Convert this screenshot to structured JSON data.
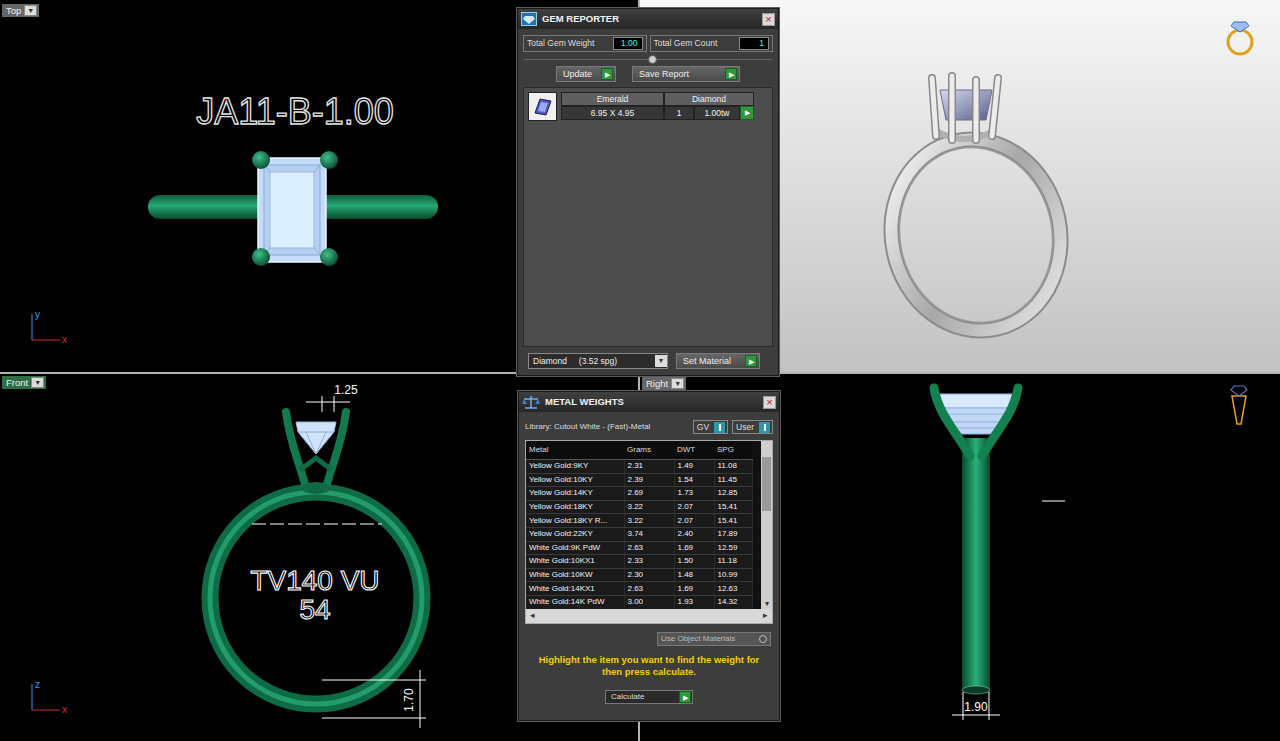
{
  "top_view": {
    "label": "Top",
    "menu": "▼",
    "selected": false,
    "part_code": "JA11-B-1.00",
    "axis_vertical": "y",
    "axis_horizontal": "x"
  },
  "front_view": {
    "label": "Front",
    "menu": "▼",
    "selected": true,
    "dimension_top": "1.25",
    "stamp_lines": [
      "TV140 VU",
      "54"
    ],
    "dimension_side": "1.70",
    "axis_vertical": "z",
    "axis_horizontal": "x"
  },
  "right_view": {
    "label": "Right",
    "menu": "▼",
    "selected": false,
    "dimension_bottom": "1.90"
  },
  "gem_reporter": {
    "title": "GEM REPORTER",
    "close": "×",
    "total_weight_label": "Total Gem Weight",
    "total_weight": "1.00",
    "total_count_label": "Total Gem Count",
    "total_count": "1",
    "buttons": [
      {
        "label": "Update",
        "arrow": "▶"
      },
      {
        "label": "Save Report",
        "arrow": "▶"
      }
    ],
    "gems": [
      {
        "shape": "Emerald",
        "size": "6.95 X 4.95",
        "material": "Diamond",
        "count": "1",
        "weight": "1.00tw",
        "arrow": "▶"
      }
    ],
    "material": "Diamond     (3.52 spg)",
    "material_arrow": "▼",
    "set_material": {
      "label": "Set Material",
      "arrow": "▶"
    }
  },
  "metal_weights": {
    "title": "METAL WEIGHTS",
    "close": "×",
    "library": "Library: Cutout White - (Fast)-Metal",
    "toggles": [
      {
        "label": "GV",
        "on": true
      },
      {
        "label": "User",
        "on": true
      }
    ],
    "columns": [
      "Metal",
      "Grams",
      "DWT",
      "SPG"
    ],
    "rows": [
      [
        "Yellow Gold:9KY",
        "2.31",
        "1.49",
        "11.08"
      ],
      [
        "Yellow Gold:10KY",
        "2.39",
        "1.54",
        "11.45"
      ],
      [
        "Yellow Gold:14KY",
        "2.69",
        "1.73",
        "12.85"
      ],
      [
        "Yellow Gold:18KY",
        "3.22",
        "2.07",
        "15.41"
      ],
      [
        "Yellow Gold:18KY R...",
        "3.22",
        "2.07",
        "15.41"
      ],
      [
        "Yellow Gold:22KY",
        "3.74",
        "2.40",
        "17.89"
      ],
      [
        "White Gold:9K PdW",
        "2.63",
        "1.69",
        "12.59"
      ],
      [
        "White Gold:10KX1",
        "2.33",
        "1.50",
        "11.18"
      ],
      [
        "White Gold:10KW",
        "2.30",
        "1.48",
        "10.99"
      ],
      [
        "White Gold:14KX1",
        "2.63",
        "1.69",
        "12.63"
      ],
      [
        "White Gold:14K PdW",
        "3.00",
        "1.93",
        "14.32"
      ]
    ],
    "scroll_left": "◂",
    "scroll_right": "▸",
    "scroll_down": "▾",
    "material_source": "Use Object Materials",
    "hint": "Highlight the item you want to find the weight for then press calculate.",
    "calculate": {
      "label": "Calculate",
      "arrow": "▶"
    }
  }
}
